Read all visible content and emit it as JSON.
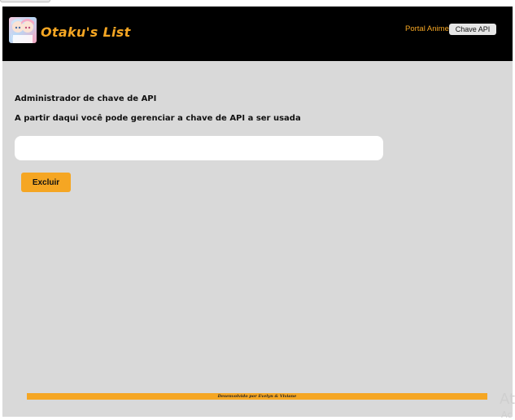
{
  "header": {
    "brand": "Otaku's List",
    "logo_icon": "anime-characters-logo",
    "nav": {
      "portal_label": "Portal Anime",
      "api_key_label": "Chave API"
    },
    "colors": {
      "background": "#000000",
      "accent": "#f5a623"
    }
  },
  "main": {
    "heading": "Administrador de chave de API",
    "subheading": "A partir daqui você pode gerenciar a chave de API a ser usada",
    "api_key_input": {
      "value": "",
      "placeholder": ""
    },
    "delete_label": "Excluir",
    "background": "#d9d9d9"
  },
  "footer": {
    "credit": "Desenvolvido por Evelyn & Viviane"
  },
  "watermark": {
    "line1": "At",
    "line2": "Ac"
  }
}
